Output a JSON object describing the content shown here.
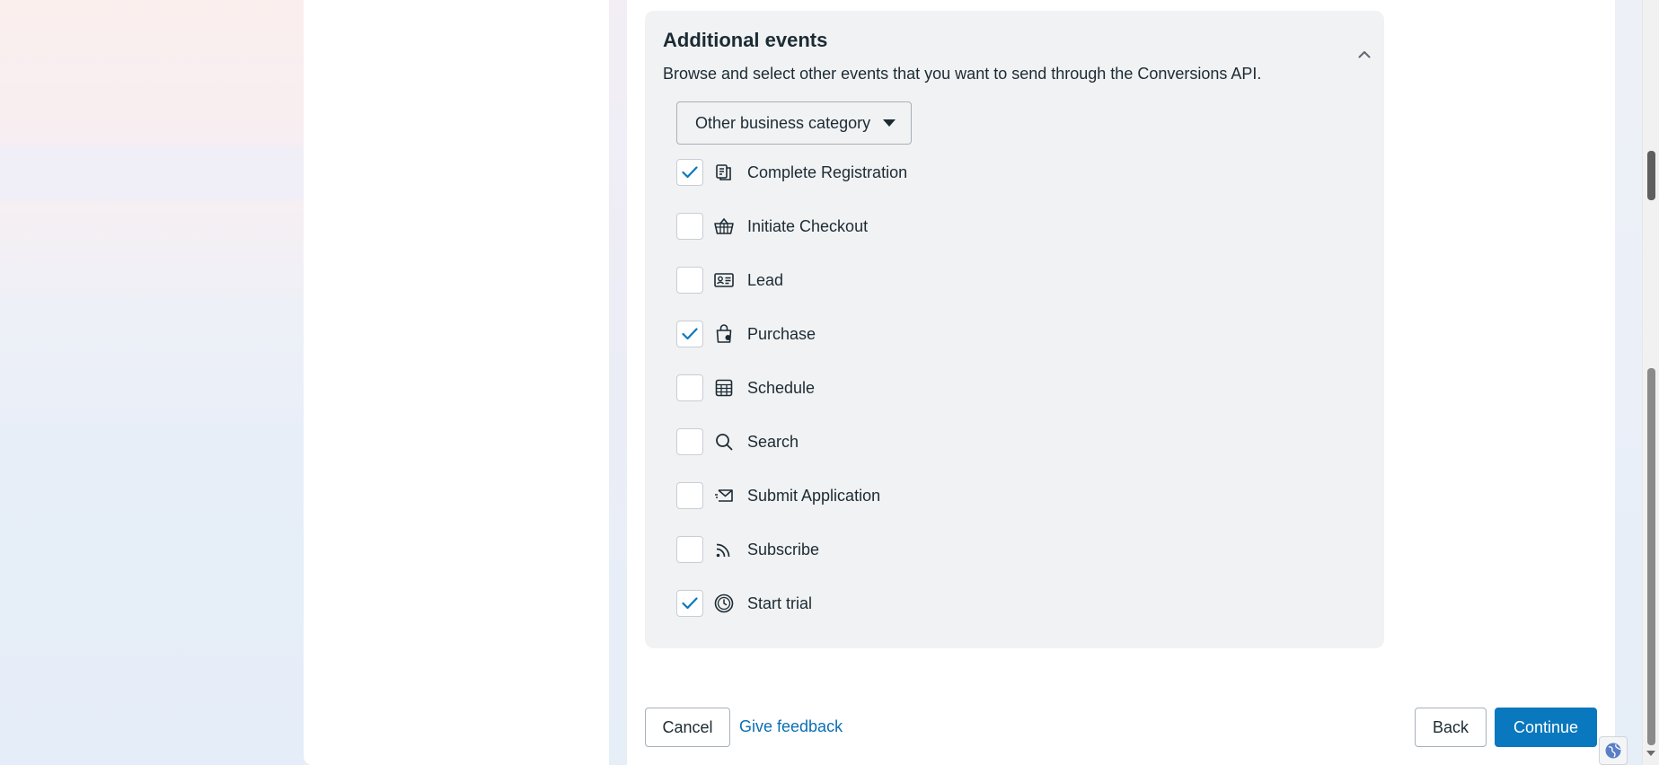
{
  "section": {
    "title": "Additional events",
    "description": "Browse and select other events that you want to send through the Conversions API.",
    "category_dropdown": "Other business category"
  },
  "events": [
    {
      "label": "Complete Registration",
      "checked": true,
      "icon": "registration-icon"
    },
    {
      "label": "Initiate Checkout",
      "checked": false,
      "icon": "basket-icon"
    },
    {
      "label": "Lead",
      "checked": false,
      "icon": "id-card-icon"
    },
    {
      "label": "Purchase",
      "checked": true,
      "icon": "shopping-bag-icon"
    },
    {
      "label": "Schedule",
      "checked": false,
      "icon": "calendar-grid-icon"
    },
    {
      "label": "Search",
      "checked": false,
      "icon": "search-icon"
    },
    {
      "label": "Submit Application",
      "checked": false,
      "icon": "send-mail-icon"
    },
    {
      "label": "Subscribe",
      "checked": false,
      "icon": "rss-icon"
    },
    {
      "label": "Start trial",
      "checked": true,
      "icon": "clock-icon"
    }
  ],
  "footer": {
    "cancel_label": "Cancel",
    "feedback_label": "Give feedback",
    "back_label": "Back",
    "continue_label": "Continue"
  },
  "colors": {
    "accent": "#0a78be",
    "link": "#0a6fb4",
    "panel_bg": "#f1f2f4",
    "text": "#1c2b33"
  }
}
